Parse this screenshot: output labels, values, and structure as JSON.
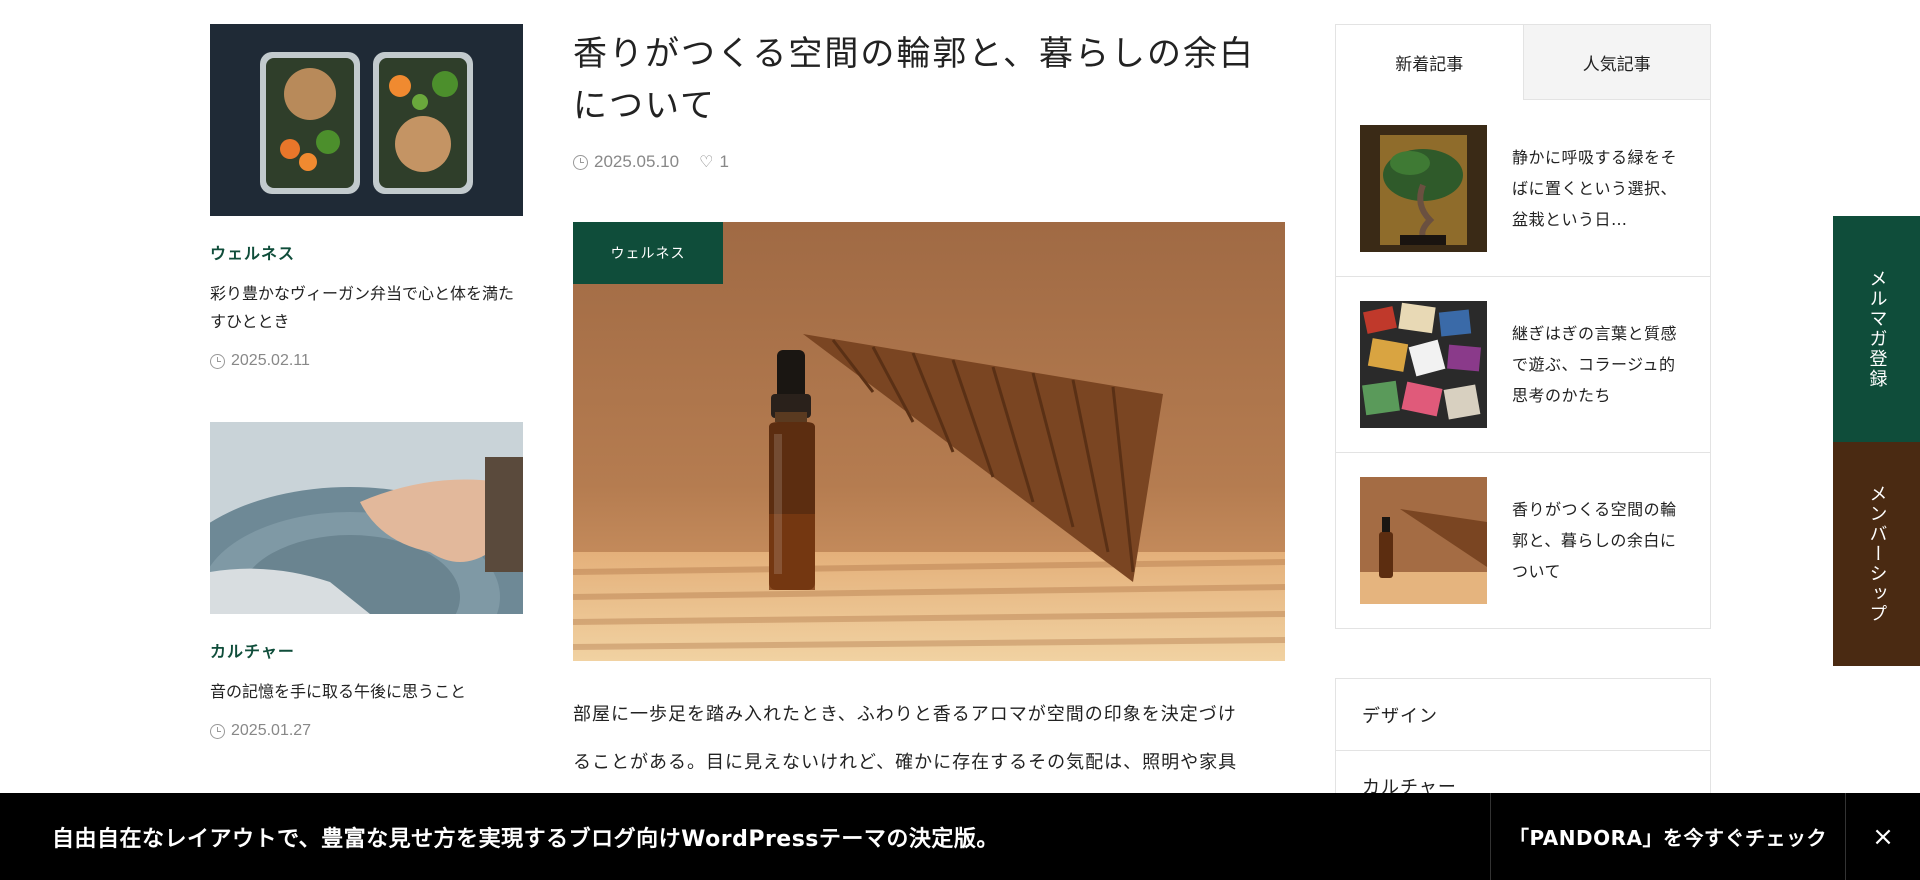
{
  "left_posts": [
    {
      "category": "ウェルネス",
      "title": "彩り豊かなヴィーガン弁当で心と体を満たすひととき",
      "date": "2025.02.11"
    },
    {
      "category": "カルチャー",
      "title": "音の記憶を手に取る午後に思うこと",
      "date": "2025.01.27"
    }
  ],
  "article": {
    "title": "香りがつくる空間の輪郭と、暮らしの余白について",
    "date": "2025.05.10",
    "likes": "1",
    "category_badge": "ウェルネス",
    "body_line1": "部屋に一歩足を踏み入れたとき、ふわりと香るアロマが空間の印象を決定づけ",
    "body_line2": "ることがある。目に見えないけれど、確かに存在するその気配は、照明や家具"
  },
  "sidebar": {
    "tabs": [
      {
        "label": "新着記事"
      },
      {
        "label": "人気記事"
      }
    ],
    "posts": [
      {
        "title": "静かに呼吸する緑をそばに置くという選択、盆栽という日…"
      },
      {
        "title": "継ぎはぎの言葉と質感で遊ぶ、コラージュ的思考のかたち"
      },
      {
        "title": "香りがつくる空間の輪郭と、暮らしの余白について"
      }
    ],
    "categories": [
      {
        "label": "デザイン"
      },
      {
        "label": "カルチャー"
      }
    ]
  },
  "side_tabs": {
    "newsletter": "メルマガ登録",
    "membership": "メンバーシップ"
  },
  "banner": {
    "text": "自由自在なレイアウトで、豊富な見せ方を実現するブログ向けWordPressテーマの決定版。",
    "cta": "「PANDORA」を今すぐチェック",
    "close_icon": "×"
  },
  "icons": {
    "clock": "clock-icon",
    "heart": "heart-icon",
    "close": "close-icon"
  },
  "colors": {
    "accent_green": "#0f4d3a",
    "accent_brown": "#4a2a12",
    "banner_bg": "#000000"
  }
}
